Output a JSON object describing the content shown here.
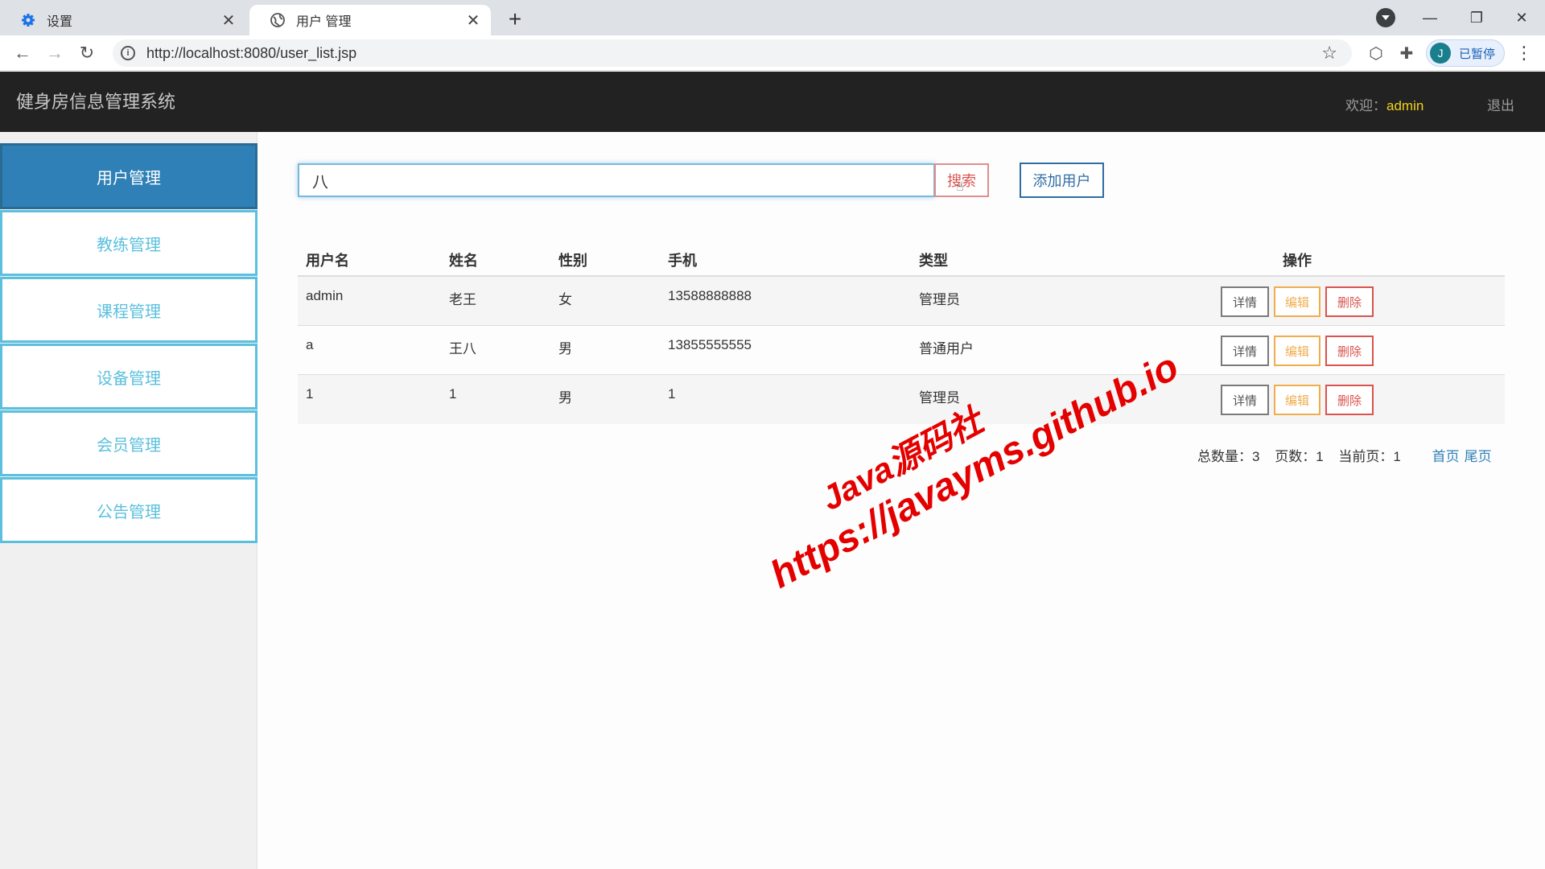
{
  "browser": {
    "tabs": [
      {
        "title": "设置",
        "icon": "gear-icon"
      },
      {
        "title": "用户 管理",
        "icon": "globe-icon"
      }
    ],
    "url": "http://localhost:8080/user_list.jsp",
    "profile_initial": "J",
    "profile_status": "已暂停"
  },
  "header": {
    "title": "健身房信息管理系统",
    "welcome_label": "欢迎：",
    "username": "admin",
    "logout": "退出"
  },
  "sidebar": {
    "items": [
      {
        "label": "用户管理"
      },
      {
        "label": "教练管理"
      },
      {
        "label": "课程管理"
      },
      {
        "label": "设备管理"
      },
      {
        "label": "会员管理"
      },
      {
        "label": "公告管理"
      }
    ]
  },
  "search": {
    "value": "八",
    "button": "搜索",
    "add_button": "添加用户"
  },
  "table": {
    "headers": [
      "用户名",
      "姓名",
      "性别",
      "手机",
      "类型",
      "操作"
    ],
    "rows": [
      [
        "admin",
        "老王",
        "女",
        "13588888888",
        "管理员"
      ],
      [
        "a",
        "王八",
        "男",
        "13855555555",
        "普通用户"
      ],
      [
        "1",
        "1",
        "男",
        "1",
        "管理员"
      ]
    ],
    "actions": {
      "detail": "详情",
      "edit": "编辑",
      "delete": "删除"
    }
  },
  "pagination": {
    "total_label": "总数量：",
    "total": "3",
    "pages_label": "页数：",
    "pages": "1",
    "current_label": "当前页：",
    "current": "1",
    "first": "首页",
    "last": "尾页"
  },
  "watermark": {
    "line1": "Java源码社",
    "line2": "https://javayms.github.io"
  },
  "colors": {
    "header_bg": "#222222",
    "active_sidebar": "#2e80b6",
    "sidebar_accent": "#5bc0de",
    "username": "#f1d21b",
    "watermark": "#e50000"
  }
}
